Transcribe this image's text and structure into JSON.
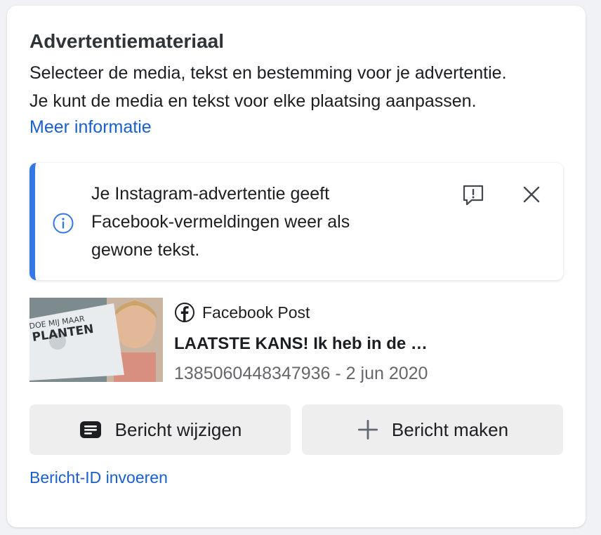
{
  "section": {
    "title": "Advertentiemateriaal",
    "description_line1": "Selecteer de media, tekst en bestemming voor je advertentie.",
    "description_line2": "Je kunt de media en tekst voor elke plaatsing aanpassen.",
    "more_link": "Meer informatie"
  },
  "notice": {
    "icon": "info-icon",
    "text_line1": "Je Instagram-advertentie geeft",
    "text_line2": "Facebook-vermeldingen weer als",
    "text_line3": "gewone tekst.",
    "feedback_icon": "feedback-icon",
    "close_icon": "close-icon",
    "accent_color": "#3577e5"
  },
  "post": {
    "source_icon": "facebook-icon",
    "source": "Facebook Post",
    "title": "LAATSTE KANS! Ik heb in de …",
    "meta": "1385060448347936 - 2 jun 2020",
    "thumbnail_text_line1": "DOE MIJ MAAR",
    "thumbnail_text_line2": "PLANTEN"
  },
  "actions": {
    "edit_label": "Bericht wijzigen",
    "edit_icon": "message-icon",
    "create_label": "Bericht maken",
    "create_icon": "plus-icon",
    "id_link": "Bericht-ID invoeren"
  },
  "colors": {
    "link": "#1a5fd0",
    "button_bg": "#eeeeef",
    "muted_text": "#65676b"
  }
}
